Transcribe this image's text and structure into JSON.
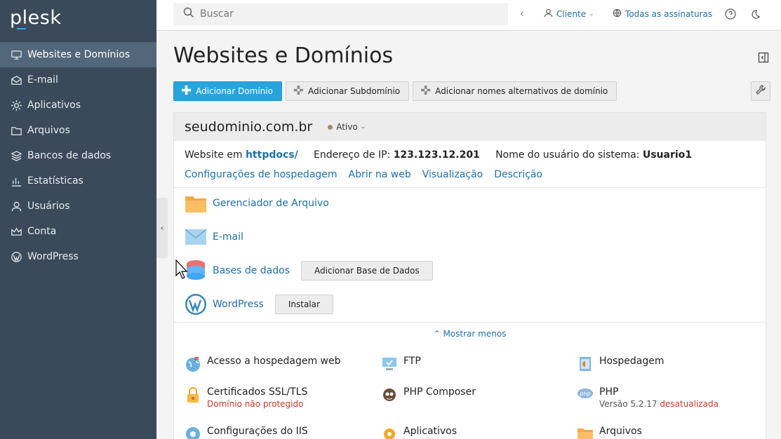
{
  "app": {
    "logo": "plesk"
  },
  "sidebar": {
    "items": [
      {
        "label": "Websites e Domínios",
        "icon": "monitor-icon",
        "active": true
      },
      {
        "label": "E-mail",
        "icon": "mail-icon"
      },
      {
        "label": "Aplicativos",
        "icon": "gear-icon"
      },
      {
        "label": "Arquivos",
        "icon": "folder-icon"
      },
      {
        "label": "Bancos de dados",
        "icon": "database-icon"
      },
      {
        "label": "Estatísticas",
        "icon": "chart-icon"
      },
      {
        "label": "Usuários",
        "icon": "user-icon"
      },
      {
        "label": "Conta",
        "icon": "crown-icon"
      },
      {
        "label": "WordPress",
        "icon": "wordpress-icon"
      }
    ]
  },
  "header": {
    "search_placeholder": "Buscar",
    "client_label": "Cliente",
    "subscriptions_label": "Todas as assinaturas"
  },
  "main": {
    "title": "Websites e Domínios",
    "toolbar": {
      "add_domain": "Adicionar Domínio",
      "add_subdomain": "Adicionar Subdomínio",
      "add_alias": "Adicionar nomes alternativos de domínio"
    },
    "domain": {
      "name": "seudominio.com.br",
      "status": "Ativo",
      "website_prefix": "Website em",
      "website_path": "httpdocs/",
      "ip_label": "Endereço de IP:",
      "ip_value": "123.123.12.201",
      "user_label": "Nome do usuário do sistema:",
      "user_value": "Usuario1",
      "links": [
        "Configurações de hospedagem",
        "Abrir na web",
        "Visualização",
        "Descrição"
      ]
    },
    "tools": {
      "file_manager": "Gerenciador de Arquivo",
      "email": "E-mail",
      "databases": "Bases de dados",
      "add_database": "Adicionar Base de Dados",
      "wordpress": "WordPress",
      "install": "Instalar"
    },
    "show_less": "Mostrar menos",
    "grid": {
      "web_access": "Acesso a hospedagem web",
      "ftp": "FTP",
      "hosting": "Hospedagem",
      "ssl": "Certificados SSL/TLS",
      "ssl_sub": "Domínio não protegido",
      "composer": "PHP Composer",
      "php": "PHP",
      "php_version": "Versão 5.2.17",
      "php_outdated": "desatualizada",
      "iis": "Configurações do IIS",
      "apps": "Aplicativos",
      "files": "Arquivos"
    }
  },
  "colors": {
    "sidebar": "#3b4a5a",
    "accent": "#28a4dc",
    "link": "#1f6fa7",
    "warning": "#c0392b"
  }
}
